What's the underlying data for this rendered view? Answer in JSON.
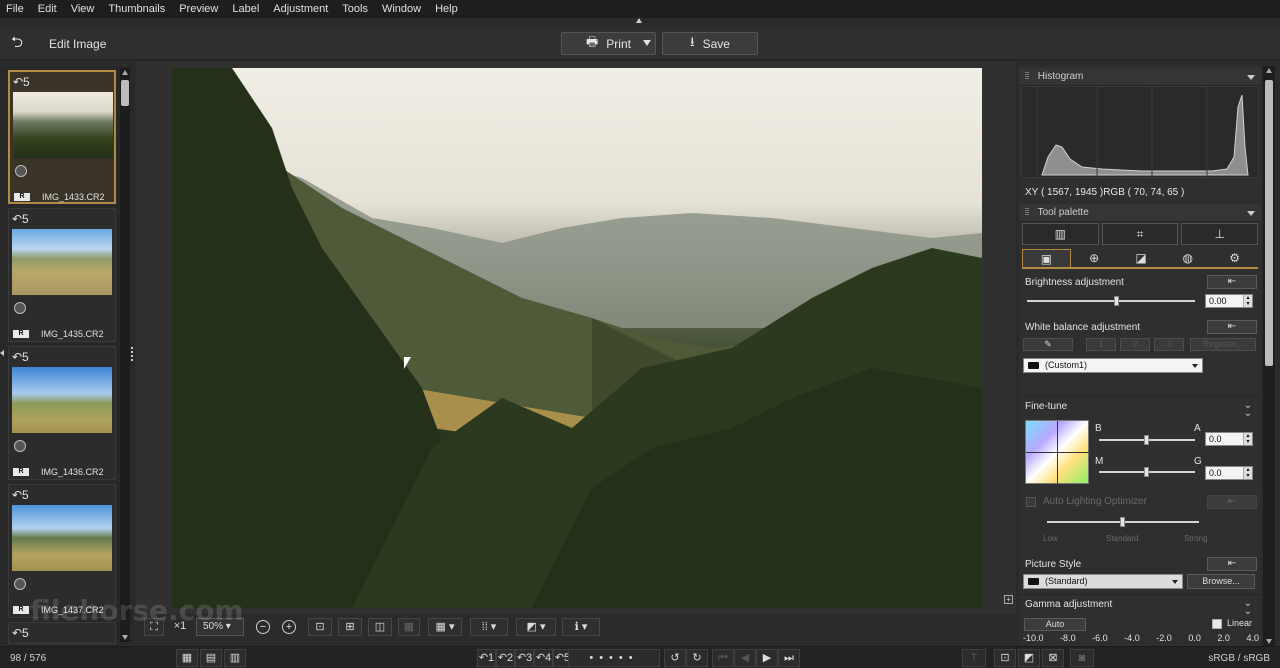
{
  "menu": [
    "File",
    "Edit",
    "View",
    "Thumbnails",
    "Preview",
    "Label",
    "Adjustment",
    "Tools",
    "Window",
    "Help"
  ],
  "toolbar": {
    "title": "Edit Image",
    "print_label": "Print",
    "save_label": "Save"
  },
  "thumbnails": [
    {
      "name": "IMG_1433.CR2",
      "rotation": "↶5",
      "badge": "R"
    },
    {
      "name": "IMG_1435.CR2",
      "rotation": "↶5",
      "badge": "R"
    },
    {
      "name": "IMG_1436.CR2",
      "rotation": "↶5",
      "badge": "R"
    },
    {
      "name": "IMG_1437.CR2",
      "rotation": "↶5",
      "badge": "R"
    }
  ],
  "panels": {
    "histogram_title": "Histogram",
    "xy_readout": "XY ( 1567, 1945 )RGB (  70,  74,  65 )",
    "tool_palette_title": "Tool palette"
  },
  "brightness": {
    "label": "Brightness adjustment",
    "value": "0.00",
    "level": 0.5
  },
  "white_balance": {
    "label": "White balance adjustment",
    "num_1": "1",
    "num_2": "2",
    "num_3": "3",
    "register_label": "Register...",
    "preset": "(Custom1)"
  },
  "fine_tune": {
    "label": "Fine-tune",
    "b_label": "B",
    "a_label": "A",
    "m_label": "M",
    "g_label": "G",
    "ba_value": "0.0",
    "mg_value": "0.0"
  },
  "auto_lighting": {
    "label": "Auto Lighting Optimizer",
    "low": "Low",
    "standard": "Standard",
    "strong": "Strong"
  },
  "picture_style": {
    "label": "Picture Style",
    "preset": "(Standard)",
    "browse_label": "Browse..."
  },
  "gamma": {
    "label": "Gamma adjustment",
    "auto_label": "Auto",
    "linear_label": "Linear",
    "scale": [
      "-10.0",
      "-8.0",
      "-6.0",
      "-4.0",
      "-2.0",
      "0.0",
      "2.0",
      "4.0"
    ]
  },
  "preview_toolbar": {
    "zoom_prefix": "×1",
    "zoom": "50%"
  },
  "status": {
    "count": "98 / 576",
    "nav_1": "↶1",
    "nav_2": "↶2",
    "nav_3": "↶3",
    "nav_4": "↶4",
    "nav_5": "↶5",
    "color_space": "sRGB / sRGB"
  },
  "watermark": "filehorse.com",
  "colors": {
    "accent": "#b38a44",
    "background": "#2b2b2b"
  }
}
